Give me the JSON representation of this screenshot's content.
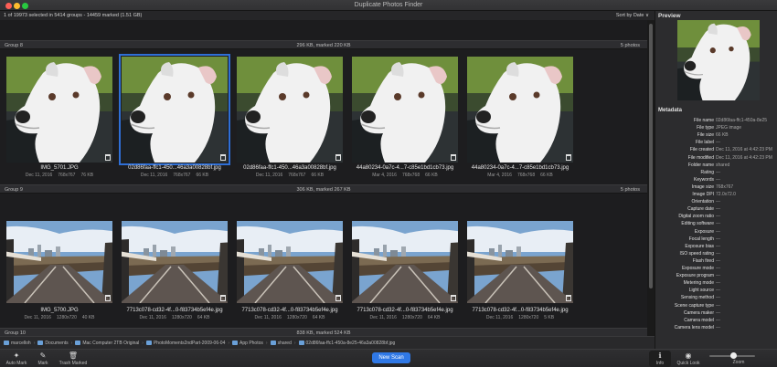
{
  "window": {
    "title": "Duplicate Photos Finder"
  },
  "infobar": {
    "selection_info": "1 of 19973 selected in 5414 groups - 14459 marked (1.51 GB)",
    "sort_label": "Sort by Date ∨"
  },
  "groups": [
    {
      "name": "Group 8",
      "size": "296 KB, marked 220 KB",
      "count": "5 photos",
      "kind": "dog",
      "photos": [
        {
          "name": "IMG_5701.JPG",
          "date": "Dec 11, 2016",
          "dims": "768x767",
          "size": "76 KB",
          "selected": false
        },
        {
          "name": "02d86faa-ffc1-450...46a3a00828bf.jpg",
          "date": "Dec 11, 2016",
          "dims": "768x767",
          "size": "66 KB",
          "selected": true
        },
        {
          "name": "02d86faa-ffc1-450...46a3a00828bf.jpg",
          "date": "Dec 11, 2016",
          "dims": "768x767",
          "size": "66 KB",
          "selected": false
        },
        {
          "name": "44a80234-0a7c-4...7-c85e1bd1cb73.jpg",
          "date": "Mar 4, 2016",
          "dims": "768x768",
          "size": "66 KB",
          "selected": false
        },
        {
          "name": "44a80234-0a7c-4...7-c85e1bd1cb73.jpg",
          "date": "Mar 4, 2016",
          "dims": "768x768",
          "size": "66 KB",
          "selected": false
        }
      ]
    },
    {
      "name": "Group 9",
      "size": "306 KB, marked 267 KB",
      "count": "5 photos",
      "kind": "rail",
      "photos": [
        {
          "name": "IMG_5700.JPG",
          "date": "Dec 11, 2016",
          "dims": "1280x720",
          "size": "40 KB",
          "selected": false
        },
        {
          "name": "7713c078-cd32-4f...0-f83734b5ef4e.jpg",
          "date": "Dec 11, 2016",
          "dims": "1280x720",
          "size": "64 KB",
          "selected": false
        },
        {
          "name": "7713c078-cd32-4f...0-f83734b5ef4e.jpg",
          "date": "Dec 11, 2016",
          "dims": "1280x720",
          "size": "64 KB",
          "selected": false
        },
        {
          "name": "7713c078-cd32-4f...0-f83734b5ef4e.jpg",
          "date": "Dec 11, 2016",
          "dims": "1280x720",
          "size": "64 KB",
          "selected": false
        },
        {
          "name": "7713c078-cd32-4f...0-f83734b5ef4e.jpg",
          "date": "Dec 11, 2016",
          "dims": "1280x720",
          "size": "5 KB",
          "selected": false
        }
      ]
    },
    {
      "name": "Group 10",
      "size": "838 KB, marked 524 KB",
      "count": "",
      "kind": "none",
      "photos": []
    }
  ],
  "path": [
    "marcelloh",
    "Documents",
    "Mac Computer 2TB Original",
    "PhotoMoments2ndPart-2009-06-04",
    "App Photos",
    "shared",
    "02d86faa-ffc1-450a-8e25-46a3a00828bf.jpg"
  ],
  "toolbar": {
    "auto_mark": "Auto Mark",
    "mark": "Mark",
    "trash_marked": "Trash Marked",
    "new_scan": "New Scan",
    "info": "Info",
    "quick_look": "Quick Look",
    "zoom": "Zoom"
  },
  "preview": {
    "title": "Preview"
  },
  "metadata": {
    "title": "Metadata",
    "rows": [
      {
        "key": "File name",
        "value": "02d86faa-ffc1-450a-8e25"
      },
      {
        "key": "File type",
        "value": "JPEG image"
      },
      {
        "key": "File size",
        "value": "66 KB"
      },
      {
        "key": "File label",
        "value": "---"
      },
      {
        "key": "File created",
        "value": "Dec 11, 2016 at 4:42:23 PM"
      },
      {
        "key": "File modified",
        "value": "Dec 11, 2016 at 4:42:23 PM"
      },
      {
        "key": "Folder name",
        "value": "shared"
      },
      {
        "key": "Rating",
        "value": "---"
      },
      {
        "key": "Keywords",
        "value": "---"
      },
      {
        "key": "Image size",
        "value": "768x767"
      },
      {
        "key": "Image DPI",
        "value": "72.0x72.0"
      },
      {
        "key": "Orientation",
        "value": "---"
      },
      {
        "key": "Capture date",
        "value": "---"
      },
      {
        "key": "Digital zoom ratio",
        "value": "---"
      },
      {
        "key": "Editing software",
        "value": "---"
      },
      {
        "key": "Exposure",
        "value": "---"
      },
      {
        "key": "Focal length",
        "value": "---"
      },
      {
        "key": "Exposure bias",
        "value": "---"
      },
      {
        "key": "ISO speed rating",
        "value": "---"
      },
      {
        "key": "Flash fired",
        "value": "---"
      },
      {
        "key": "Exposure mode",
        "value": "---"
      },
      {
        "key": "Exposure program",
        "value": "---"
      },
      {
        "key": "Metering mode",
        "value": "---"
      },
      {
        "key": "Light source",
        "value": "---"
      },
      {
        "key": "Sensing method",
        "value": "---"
      },
      {
        "key": "Scene capture type",
        "value": "---"
      },
      {
        "key": "Camera maker",
        "value": "---"
      },
      {
        "key": "Camera model",
        "value": "---"
      },
      {
        "key": "Camera lens model",
        "value": "---"
      }
    ]
  },
  "colors": {
    "accent": "#2f78e6",
    "selection": "#2f6fd6"
  }
}
